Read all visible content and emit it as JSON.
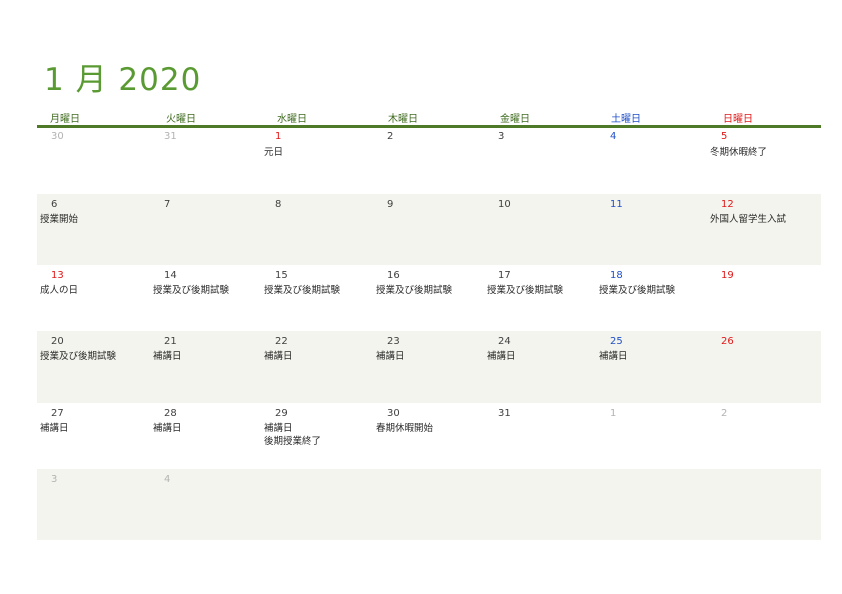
{
  "title": "1 月 2020",
  "weekdays": [
    {
      "label": "月曜日",
      "type": "weekday"
    },
    {
      "label": "火曜日",
      "type": "weekday"
    },
    {
      "label": "水曜日",
      "type": "weekday"
    },
    {
      "label": "木曜日",
      "type": "weekday"
    },
    {
      "label": "金曜日",
      "type": "weekday"
    },
    {
      "label": "土曜日",
      "type": "sat"
    },
    {
      "label": "日曜日",
      "type": "sun"
    }
  ],
  "weeks": [
    [
      {
        "day": "30",
        "kind": "other",
        "events": []
      },
      {
        "day": "31",
        "kind": "other",
        "events": []
      },
      {
        "day": "1",
        "kind": "sun",
        "events": [
          "元日"
        ]
      },
      {
        "day": "2",
        "kind": "normal",
        "events": []
      },
      {
        "day": "3",
        "kind": "normal",
        "events": []
      },
      {
        "day": "4",
        "kind": "sat",
        "events": []
      },
      {
        "day": "5",
        "kind": "sun",
        "events": [
          "冬期休暇終了"
        ]
      }
    ],
    [
      {
        "day": "6",
        "kind": "normal",
        "events": [
          "授業開始"
        ]
      },
      {
        "day": "7",
        "kind": "normal",
        "events": []
      },
      {
        "day": "8",
        "kind": "normal",
        "events": []
      },
      {
        "day": "9",
        "kind": "normal",
        "events": []
      },
      {
        "day": "10",
        "kind": "normal",
        "events": []
      },
      {
        "day": "11",
        "kind": "sat",
        "events": []
      },
      {
        "day": "12",
        "kind": "sun",
        "events": [
          "外国人留学生入試"
        ]
      }
    ],
    [
      {
        "day": "13",
        "kind": "sun",
        "events": [
          "成人の日"
        ]
      },
      {
        "day": "14",
        "kind": "normal",
        "events": [
          "授業及び後期試験"
        ]
      },
      {
        "day": "15",
        "kind": "normal",
        "events": [
          "授業及び後期試験"
        ]
      },
      {
        "day": "16",
        "kind": "normal",
        "events": [
          "授業及び後期試験"
        ]
      },
      {
        "day": "17",
        "kind": "normal",
        "events": [
          "授業及び後期試験"
        ]
      },
      {
        "day": "18",
        "kind": "sat",
        "events": [
          "授業及び後期試験"
        ]
      },
      {
        "day": "19",
        "kind": "sun",
        "events": []
      }
    ],
    [
      {
        "day": "20",
        "kind": "normal",
        "events": [
          "授業及び後期試験"
        ]
      },
      {
        "day": "21",
        "kind": "normal",
        "events": [
          "補講日"
        ]
      },
      {
        "day": "22",
        "kind": "normal",
        "events": [
          "補講日"
        ]
      },
      {
        "day": "23",
        "kind": "normal",
        "events": [
          "補講日"
        ]
      },
      {
        "day": "24",
        "kind": "normal",
        "events": [
          "補講日"
        ]
      },
      {
        "day": "25",
        "kind": "sat",
        "events": [
          "補講日"
        ]
      },
      {
        "day": "26",
        "kind": "sun",
        "events": []
      }
    ],
    [
      {
        "day": "27",
        "kind": "normal",
        "events": [
          "補講日"
        ]
      },
      {
        "day": "28",
        "kind": "normal",
        "events": [
          "補講日"
        ]
      },
      {
        "day": "29",
        "kind": "normal",
        "events": [
          "補講日",
          "後期授業終了"
        ]
      },
      {
        "day": "30",
        "kind": "normal",
        "events": [
          "春期休暇開始"
        ]
      },
      {
        "day": "31",
        "kind": "normal",
        "events": []
      },
      {
        "day": "1",
        "kind": "other",
        "events": []
      },
      {
        "day": "2",
        "kind": "other",
        "events": []
      }
    ],
    [
      {
        "day": "3",
        "kind": "other",
        "events": []
      },
      {
        "day": "4",
        "kind": "other",
        "events": []
      },
      {
        "day": "",
        "kind": "empty",
        "events": []
      },
      {
        "day": "",
        "kind": "empty",
        "events": []
      },
      {
        "day": "",
        "kind": "empty",
        "events": []
      },
      {
        "day": "",
        "kind": "empty",
        "events": []
      },
      {
        "day": "",
        "kind": "empty",
        "events": []
      }
    ]
  ]
}
